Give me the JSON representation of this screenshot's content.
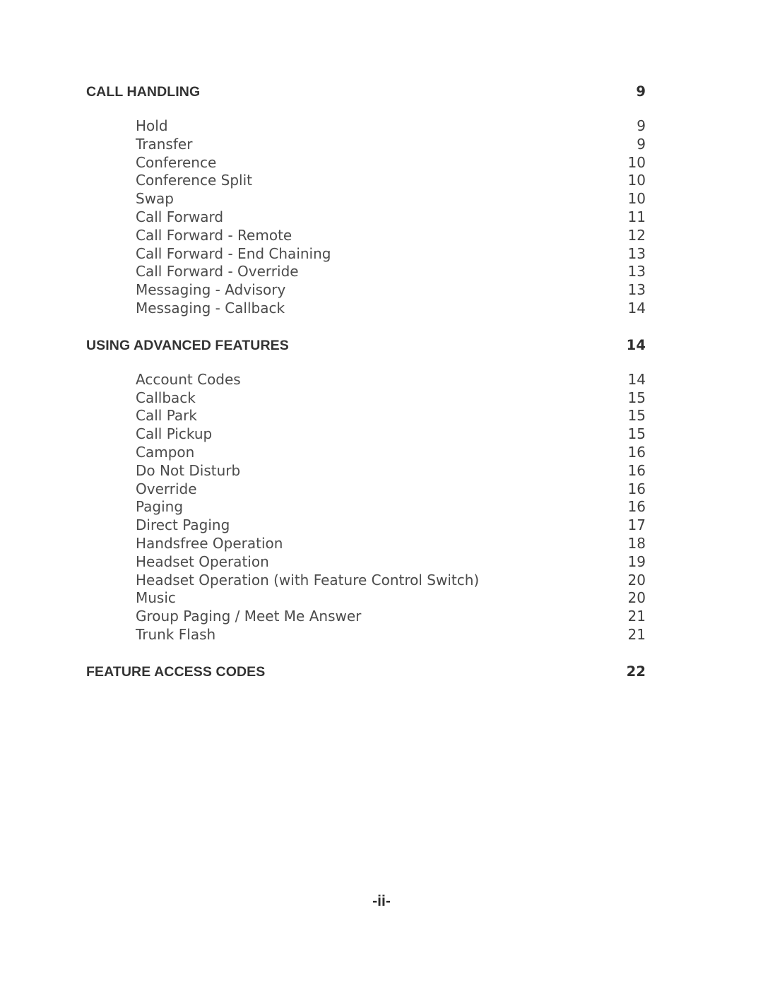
{
  "document": {
    "page_marker": "-ii-"
  },
  "toc": {
    "sections": [
      {
        "title": "CALL HANDLING",
        "page": "9",
        "entries": [
          {
            "title": "Hold",
            "page": "9"
          },
          {
            "title": "Transfer",
            "page": "9"
          },
          {
            "title": "Conference",
            "page": "10"
          },
          {
            "title": "Conference Split",
            "page": "10"
          },
          {
            "title": "Swap",
            "page": "10"
          },
          {
            "title": "Call Forward",
            "page": "11"
          },
          {
            "title": "Call Forward - Remote",
            "page": "12"
          },
          {
            "title": "Call Forward - End Chaining",
            "page": "13"
          },
          {
            "title": "Call Forward - Override",
            "page": "13"
          },
          {
            "title": "Messaging - Advisory",
            "page": "13"
          },
          {
            "title": "Messaging - Callback",
            "page": "14"
          }
        ]
      },
      {
        "title": "USING ADVANCED FEATURES",
        "page": "14",
        "entries": [
          {
            "title": "Account Codes",
            "page": "14"
          },
          {
            "title": "Callback",
            "page": "15"
          },
          {
            "title": "Call Park",
            "page": "15"
          },
          {
            "title": "Call Pickup",
            "page": "15"
          },
          {
            "title": "Campon",
            "page": "16"
          },
          {
            "title": "Do Not Disturb",
            "page": "16"
          },
          {
            "title": "Override",
            "page": "16"
          },
          {
            "title": "Paging",
            "page": "16"
          },
          {
            "title": "Direct Paging",
            "page": "17"
          },
          {
            "title": "Handsfree Operation",
            "page": "18"
          },
          {
            "title": "Headset Operation",
            "page": "19"
          },
          {
            "title": "Headset Operation (with Feature Control Switch)",
            "page": "20"
          },
          {
            "title": "Music",
            "page": "20"
          },
          {
            "title": "Group Paging / Meet Me Answer",
            "page": "21"
          },
          {
            "title": "Trunk Flash",
            "page": "21"
          }
        ]
      },
      {
        "title": "FEATURE ACCESS CODES",
        "page": "22",
        "entries": []
      }
    ]
  }
}
